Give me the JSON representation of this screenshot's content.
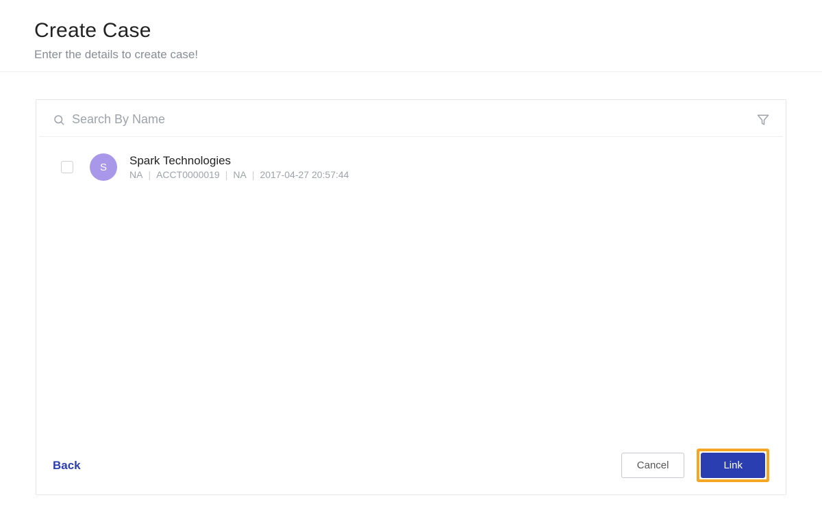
{
  "header": {
    "title": "Create Case",
    "subtitle": "Enter the details to create case!"
  },
  "search": {
    "placeholder": "Search By Name",
    "value": ""
  },
  "list": {
    "items": [
      {
        "avatar_letter": "S",
        "name": "Spark Technologies",
        "meta": [
          "NA",
          "ACCT0000019",
          "NA",
          "2017-04-27 20:57:44"
        ]
      }
    ]
  },
  "footer": {
    "back_label": "Back",
    "cancel_label": "Cancel",
    "link_label": "Link"
  }
}
